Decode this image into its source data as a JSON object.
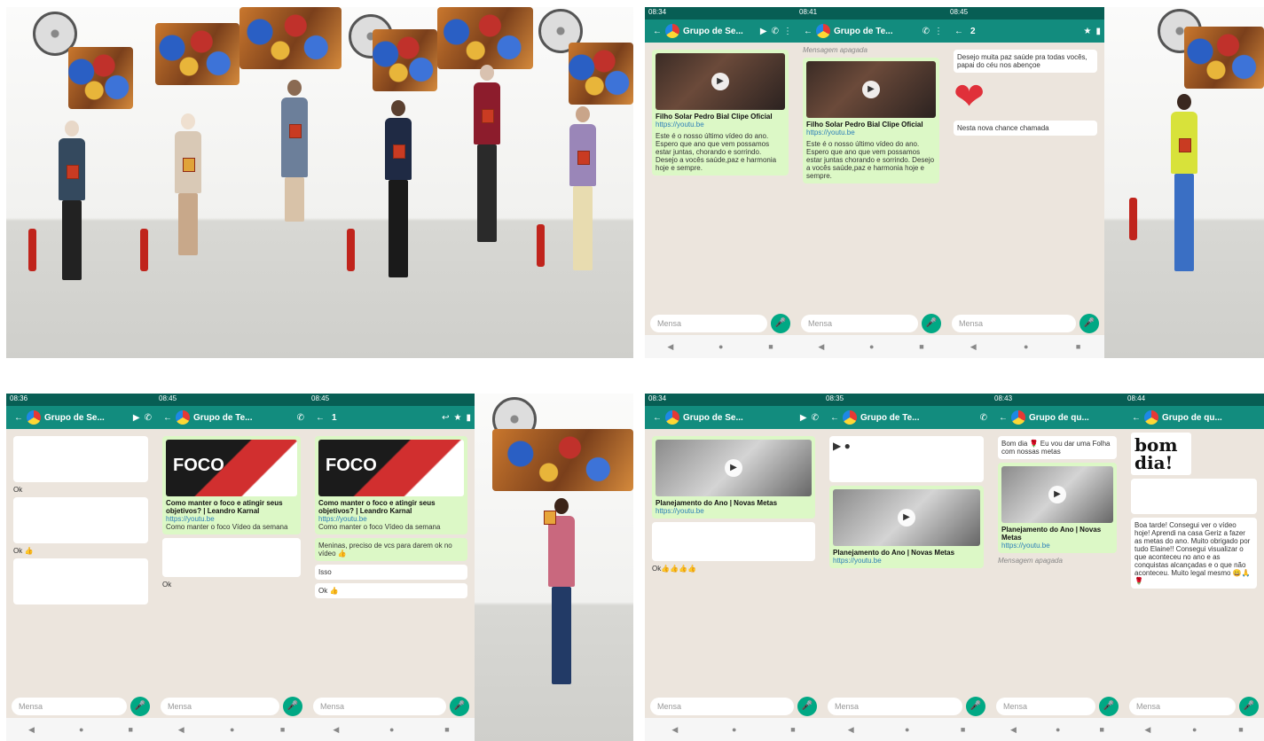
{
  "quad_top_right": {
    "screen1": {
      "time": "08:34",
      "header_title": "Grupo de Se...",
      "video_title": "Filho Solar Pedro Bial Clipe Oficial",
      "link": "https://youtu.be",
      "message": "Este é o nosso último vídeo do ano. Espero que ano que vem possamos estar juntas, chorando e sorrindo. Desejo a vocês saúde,paz e harmonia hoje e sempre.",
      "input_placeholder": "Mensa"
    },
    "screen2": {
      "time": "08:41",
      "header_title": "Grupo de Te...",
      "deleted_notice": "Mensagem apagada",
      "video_title": "Filho Solar Pedro Bial Clipe Oficial",
      "link": "https://youtu.be",
      "message": "Este é o nosso último vídeo do ano. Espero que ano que vem possamos estar juntas chorando e sorrindo. Desejo a vocês saúde,paz e harmonia hoje e sempre.",
      "input_placeholder": "Mensa"
    },
    "screen3": {
      "time": "08:45",
      "header_count": "2",
      "message": "Desejo muita paz saúde pra todas vocês, papai do céu nos abençoe",
      "heart": "❤",
      "message2": "Nesta nova chance chamada",
      "input_placeholder": "Mensa"
    }
  },
  "quad_bottom_left": {
    "screen1": {
      "time": "08:36",
      "header_title": "Grupo de Se...",
      "reply1": "Ok",
      "reply2": "Ok 👍",
      "input_placeholder": "Mensa"
    },
    "screen2": {
      "time": "08:45",
      "header_title": "Grupo de Te...",
      "video_title": "Como manter o foco e atingir seus objetivos? | Leandro Karnal",
      "thumb_text": "FOCO",
      "link": "https://youtu.be",
      "message": "Como manter o foco Vídeo da semana",
      "reply": "Ok",
      "input_placeholder": "Mensa"
    },
    "screen3": {
      "time": "08:45",
      "header_count": "1",
      "video_title": "Como manter o foco e atingir seus objetivos? | Leandro Karnal",
      "thumb_text": "FOCO",
      "link": "https://youtu.be",
      "message": "Como manter o foco Vídeo da semana",
      "message2": "Meninas, preciso de vcs para darem ok no vídeo 👍",
      "reply1": "Isso",
      "reply2": "Ok 👍",
      "input_placeholder": "Mensa"
    }
  },
  "quad_bottom_right": {
    "screen1": {
      "time": "08:34",
      "header_title": "Grupo de Se...",
      "video_title": "Planejamento do Ano | Novas Metas",
      "link": "https://youtu.be",
      "reply": "Ok👍👍👍👍",
      "input_placeholder": "Mensa"
    },
    "screen2": {
      "time": "08:35",
      "header_title": "Grupo de Te...",
      "video_title": "Planejamento do Ano | Novas Metas",
      "link": "https://youtu.be",
      "input_placeholder": "Mensa"
    },
    "screen3": {
      "time": "08:43",
      "header_title": "Grupo de qu...",
      "message": "Bom dia 🌹 Eu vou dar uma Folha com nossas metas",
      "video_title": "Planejamento do Ano | Novas Metas",
      "link": "https://youtu.be",
      "deleted_notice": "Mensagem apagada",
      "input_placeholder": "Mensa"
    },
    "screen4": {
      "time": "08:44",
      "header_title": "Grupo de qu...",
      "bomdia": "bom dia!",
      "message": "Boa tarde! Consegui ver o vídeo hoje! Aprendi na casa Geriz a fazer as metas do ano. Muito obrigado por tudo Elaine!! Consegui visualizar o que aconteceu no ano e as conquistas alcançadas e o que não aconteceu. Muito legal mesmo 😀🙏🌹",
      "input_placeholder": "Mensa"
    }
  }
}
